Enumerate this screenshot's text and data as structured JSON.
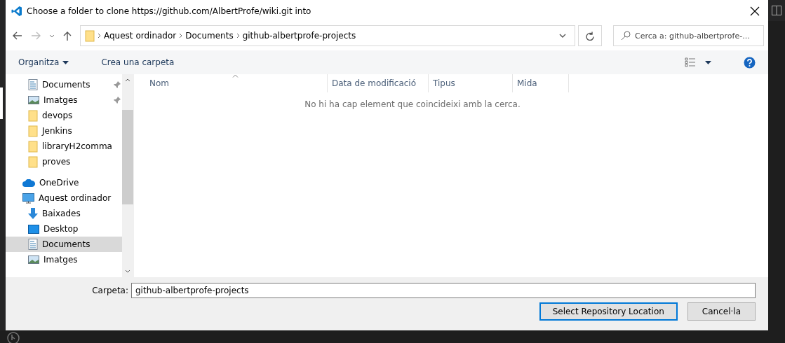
{
  "window": {
    "title": "Choose a folder to clone https://github.com/AlbertProfe/wiki.git into"
  },
  "breadcrumb": [
    "Aquest ordinador",
    "Documents",
    "github-albertprofe-projects"
  ],
  "search": {
    "placeholder": "Cerca a: github-albertprofe-..."
  },
  "toolbar": {
    "organize": "Organitza",
    "new_folder": "Crea una carpeta"
  },
  "sidebar": {
    "items": [
      {
        "label": "Documents",
        "kind": "document",
        "pinned": true,
        "selected": false
      },
      {
        "label": "Imatges",
        "kind": "picture",
        "pinned": true,
        "selected": false
      },
      {
        "label": "devops",
        "kind": "folder",
        "pinned": false,
        "selected": false
      },
      {
        "label": "Jenkins",
        "kind": "folder",
        "pinned": false,
        "selected": false
      },
      {
        "label": "libraryH2comma",
        "kind": "folder",
        "pinned": false,
        "selected": false
      },
      {
        "label": "proves",
        "kind": "folder",
        "pinned": false,
        "selected": false
      },
      {
        "label": "OneDrive",
        "kind": "cloud",
        "pinned": false,
        "selected": false
      },
      {
        "label": "Aquest ordinador",
        "kind": "computer",
        "pinned": false,
        "selected": false
      },
      {
        "label": "Baixades",
        "kind": "download",
        "pinned": false,
        "selected": false
      },
      {
        "label": "Desktop",
        "kind": "desktop",
        "pinned": false,
        "selected": false
      },
      {
        "label": "Documents",
        "kind": "document",
        "pinned": false,
        "selected": true
      },
      {
        "label": "Imatges",
        "kind": "picture",
        "pinned": false,
        "selected": false
      }
    ]
  },
  "table": {
    "columns": [
      "Nom",
      "Data de modificació",
      "Tipus",
      "Mida"
    ],
    "empty_message": "No hi ha cap element que coincideixi amb la cerca."
  },
  "folder_field": {
    "label": "Carpeta:",
    "value": "github-albertprofe-projects"
  },
  "buttons": [
    {
      "label": "Select Repository Location",
      "default": true
    },
    {
      "label": "Cancel·la",
      "default": false
    }
  ]
}
